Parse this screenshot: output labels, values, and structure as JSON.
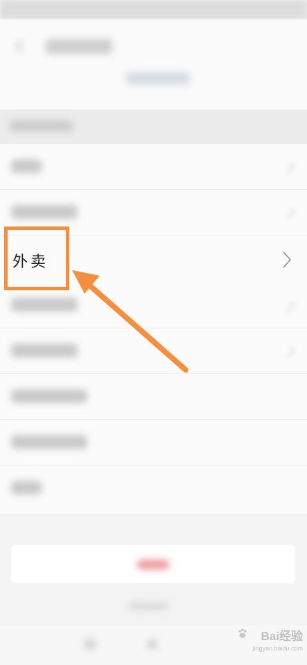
{
  "highlighted_item": {
    "label": "外卖"
  },
  "watermark": {
    "brand": "Bai经验",
    "domain": "jingyan.baidu.com"
  },
  "colors": {
    "highlight": "#f29040",
    "logout_tint": "#ef9a9a"
  },
  "icons": {
    "back": "arrow-left-icon",
    "chevron": "chevron-right-icon",
    "paw": "baidu-paw-icon"
  }
}
